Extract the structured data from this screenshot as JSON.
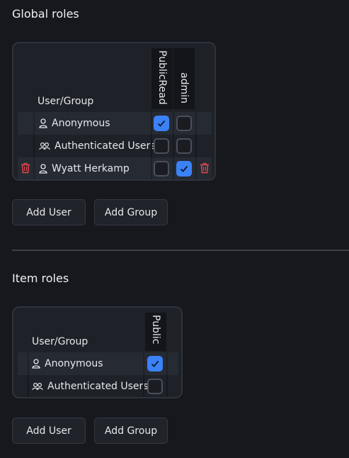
{
  "global_roles": {
    "title": "Global roles",
    "user_group_header": "User/Group",
    "columns": [
      "PublicRead",
      "admin"
    ],
    "rows": [
      {
        "name": "Anonymous",
        "icon": "user-icon",
        "values": [
          true,
          false
        ],
        "deletable": false
      },
      {
        "name": "Authenticated Users",
        "icon": "users-icon",
        "values": [
          false,
          false
        ],
        "deletable": false
      },
      {
        "name": "Wyatt Herkamp",
        "icon": "user-icon",
        "values": [
          false,
          true
        ],
        "deletable": true
      }
    ],
    "add_user_label": "Add User",
    "add_group_label": "Add Group"
  },
  "item_roles": {
    "title": "Item roles",
    "user_group_header": "User/Group",
    "columns": [
      "Public"
    ],
    "rows": [
      {
        "name": "Anonymous",
        "icon": "user-icon",
        "values": [
          true
        ]
      },
      {
        "name": "Authenticated Users",
        "icon": "users-icon",
        "values": [
          false
        ]
      }
    ],
    "add_user_label": "Add User",
    "add_group_label": "Add Group"
  },
  "colors": {
    "accent": "#3b82f6",
    "danger": "#e5484d",
    "background": "#16181d"
  }
}
